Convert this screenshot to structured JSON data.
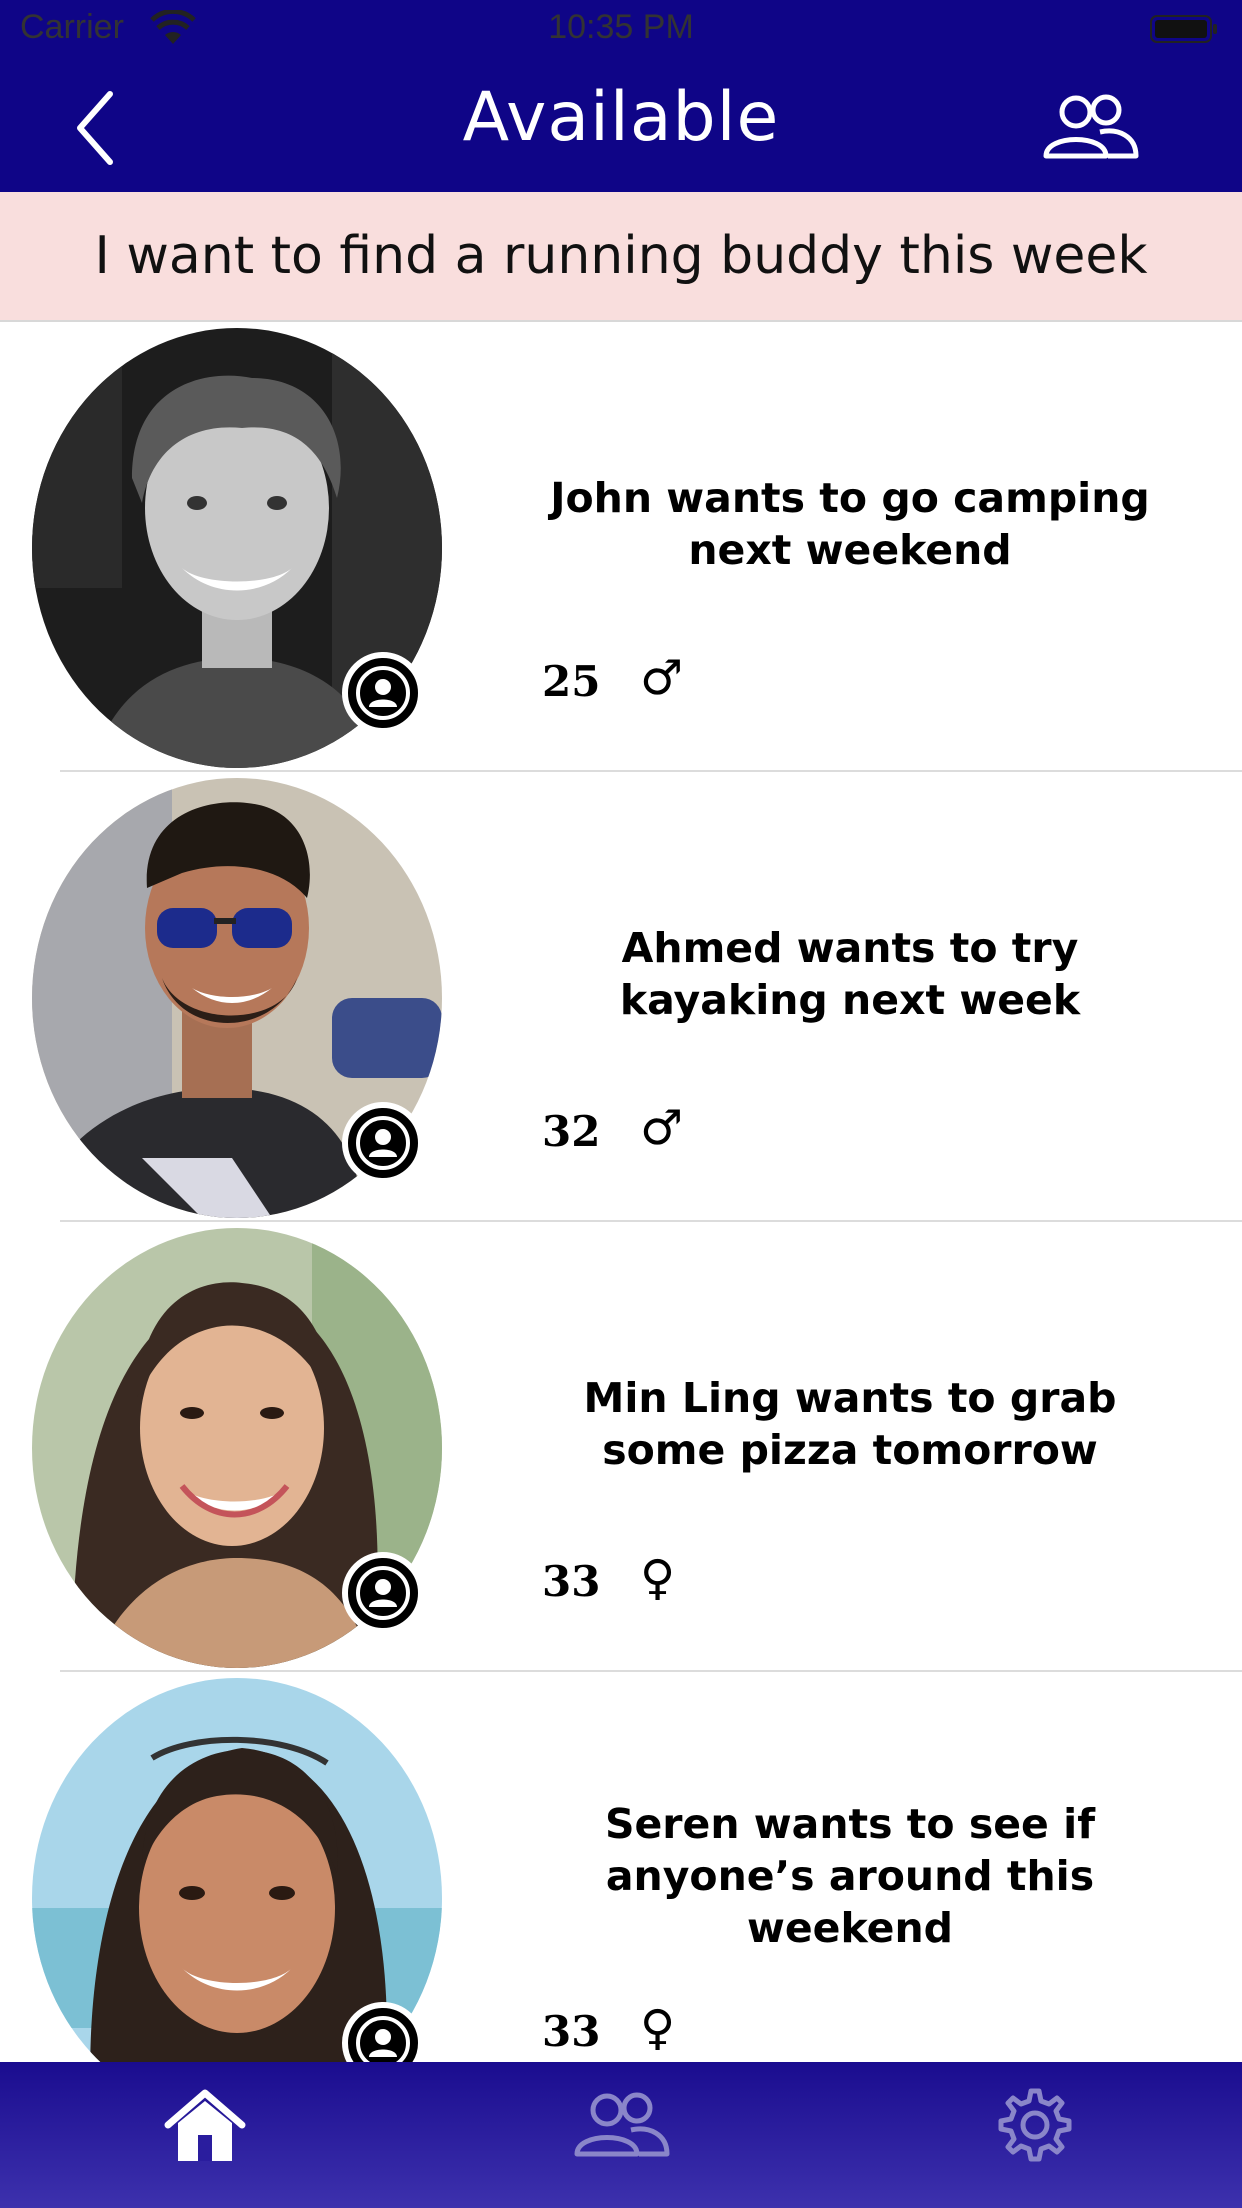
{
  "status_bar": {
    "carrier": "Carrier",
    "time": "10:35 PM"
  },
  "nav": {
    "title": "Available",
    "back_icon": "chevron-left-icon",
    "right_icon": "people-icon"
  },
  "banner": {
    "text": "I want to find a running buddy this week"
  },
  "people": [
    {
      "title": "John wants to go camping next weekend",
      "age": "25",
      "gender": "♂"
    },
    {
      "title": "Ahmed wants to try kayaking next week",
      "age": "32",
      "gender": "♂"
    },
    {
      "title": "Min Ling wants to grab some pizza tomorrow",
      "age": "33",
      "gender": "♀"
    },
    {
      "title": "Seren wants to see if anyone’s around this weekend",
      "age": "33",
      "gender": "♀"
    }
  ],
  "tabs": [
    {
      "icon": "home-icon",
      "active": true
    },
    {
      "icon": "people-icon",
      "active": false
    },
    {
      "icon": "gear-icon",
      "active": false
    }
  ],
  "colors": {
    "nav_bg": "#0f0587",
    "banner_bg": "#f9dedd",
    "tab_active": "#ffffff",
    "tab_inactive": "#8a86c9"
  }
}
